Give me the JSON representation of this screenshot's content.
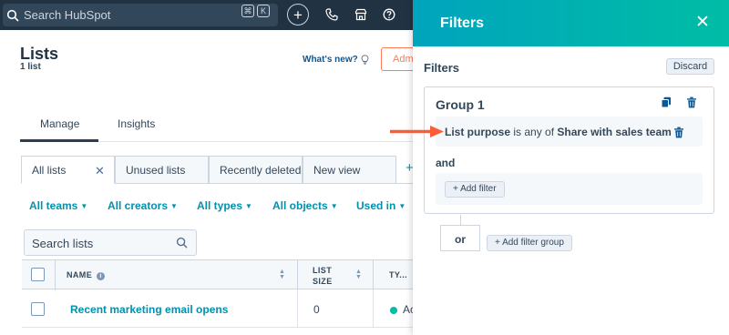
{
  "topnav": {
    "search_placeholder": "Search HubSpot",
    "kbd": [
      "⌘",
      "K"
    ],
    "icons": [
      "phone-icon",
      "marketplace-icon",
      "help-icon"
    ]
  },
  "page": {
    "title": "Lists",
    "count": "1 list",
    "whats_new": "What's new?",
    "admin_button": "Admi"
  },
  "tabs": [
    "Manage",
    "Insights"
  ],
  "views": [
    {
      "label": "All lists",
      "active": true
    },
    {
      "label": "Unused lists",
      "active": false
    },
    {
      "label": "Recently deleted",
      "active": false
    },
    {
      "label": "New view",
      "active": false
    }
  ],
  "filters": [
    "All teams",
    "All creators",
    "All types",
    "All objects",
    "Used in"
  ],
  "search_lists": {
    "placeholder": "Search lists"
  },
  "table": {
    "headers": {
      "name": "NAME",
      "list_size_1": "LIST",
      "list_size_2": "SIZE",
      "type": "TY..."
    },
    "rows": [
      {
        "name": "Recent marketing email opens",
        "size": "0",
        "type": "Ac"
      }
    ]
  },
  "panel": {
    "title": "Filters",
    "subtitle": "Filters",
    "discard": "Discard",
    "group": {
      "title": "Group 1",
      "filter": {
        "property": "List purpose",
        "operator": "is any of",
        "value": "Share with sales team"
      },
      "and": "and",
      "add_filter": "Add filter"
    },
    "or": "or",
    "add_filter_group": "Add filter group"
  },
  "colors": {
    "nav_bg": "#213343",
    "accent_teal": "#0091ae",
    "header_gradient_start": "#00a4bd",
    "header_gradient_end": "#00bda5",
    "annotation_arrow": "#ff5c35",
    "orange": "#ff7a59"
  }
}
